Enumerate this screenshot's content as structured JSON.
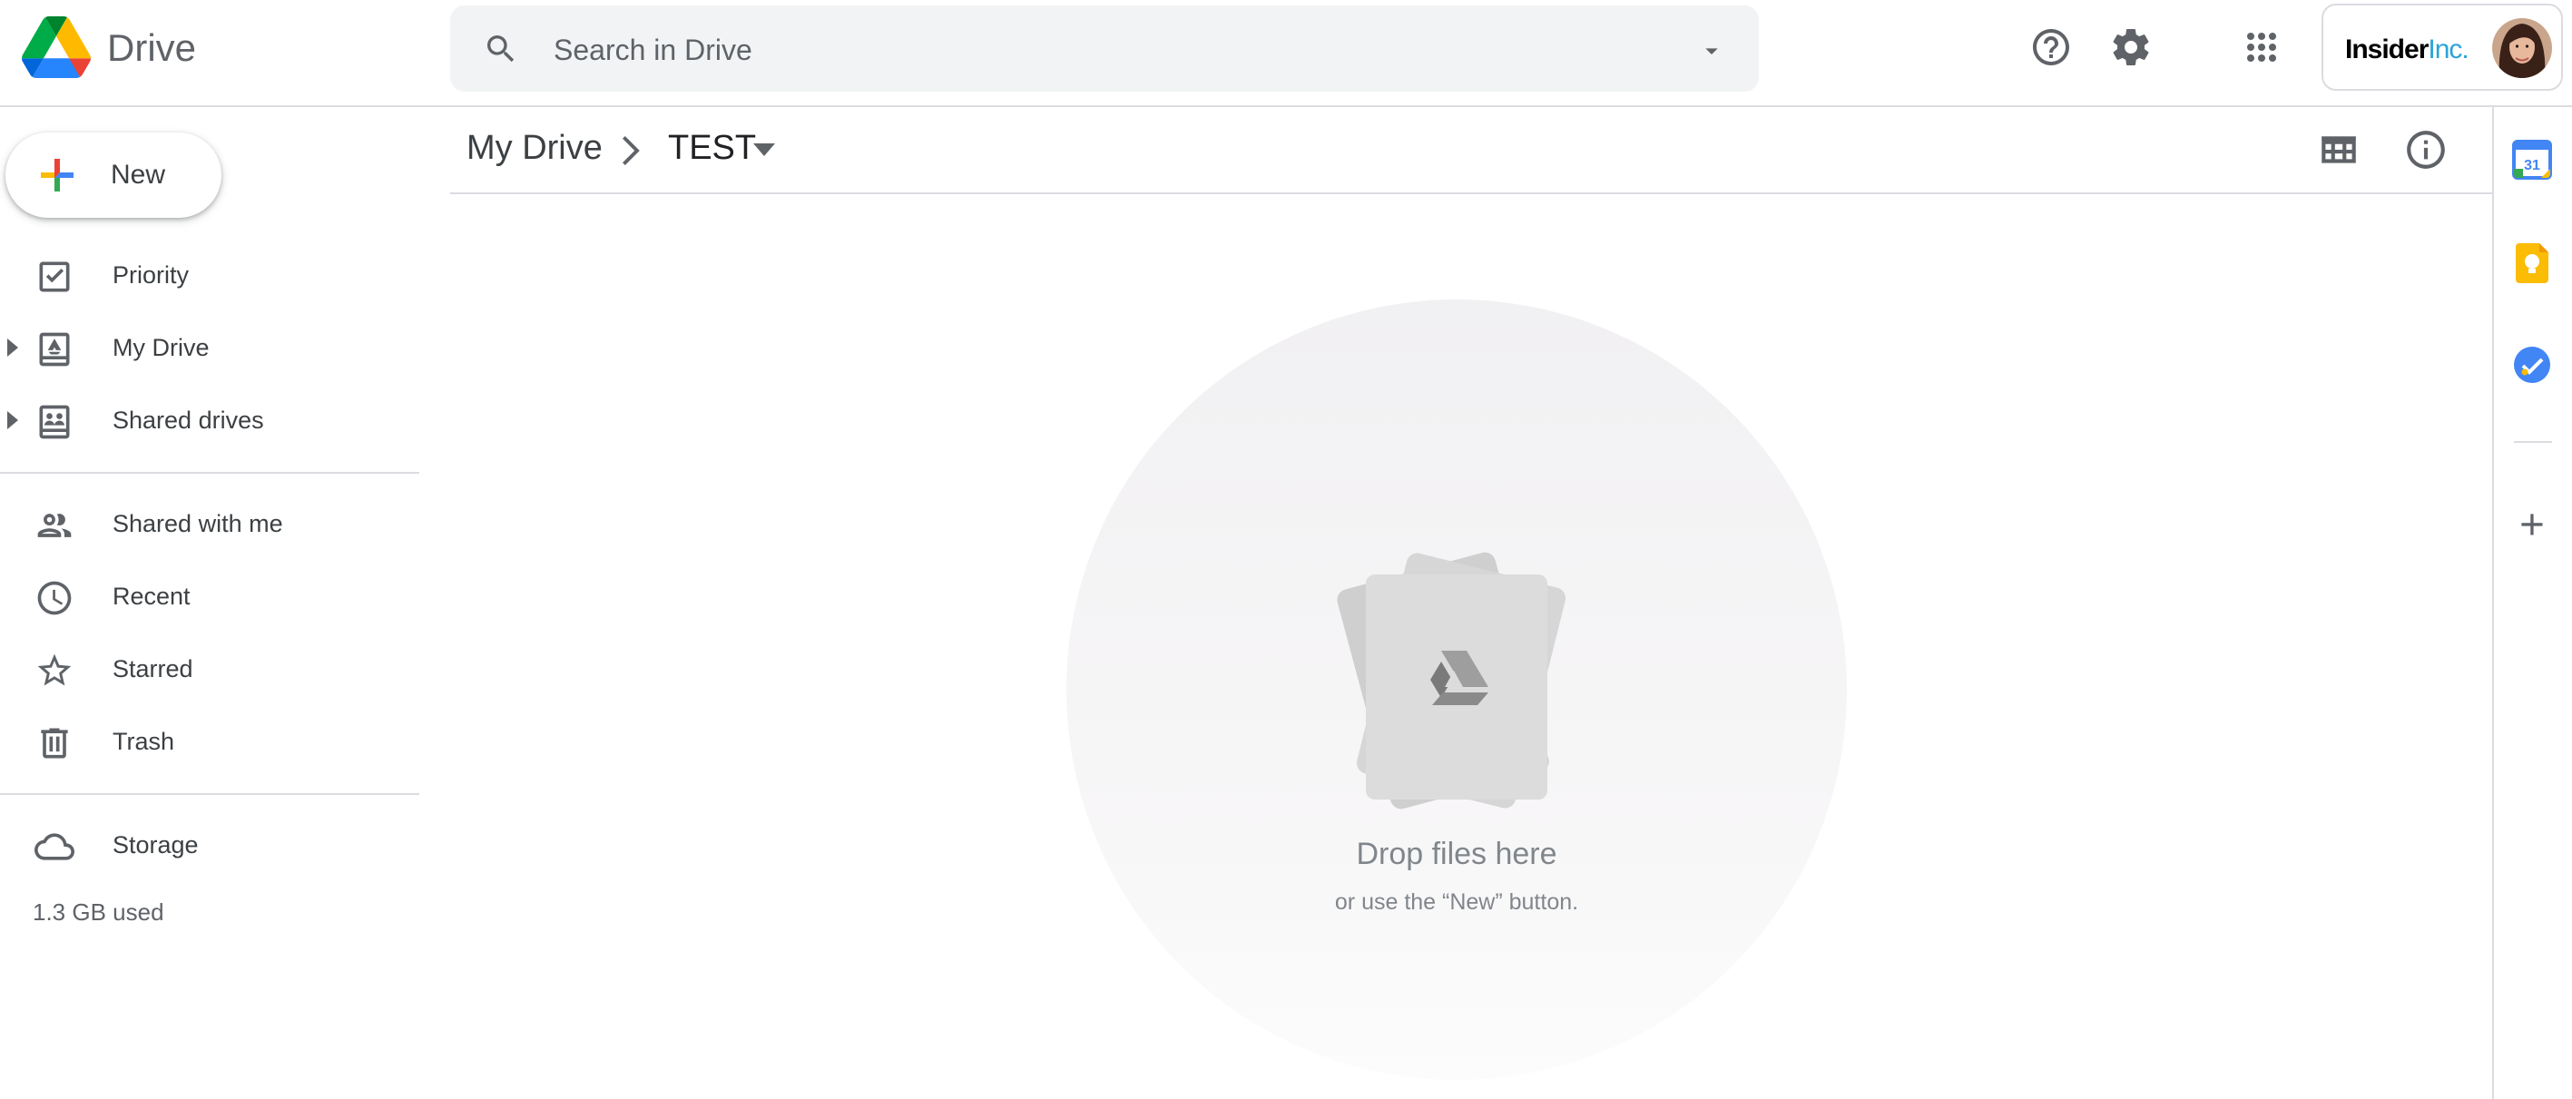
{
  "header": {
    "app_title": "Drive",
    "search": {
      "placeholder": "Search in Drive",
      "value": ""
    },
    "account": {
      "brand_bold": "Insider",
      "brand_light": "Inc."
    }
  },
  "nav": {
    "new_label": "New",
    "items": [
      {
        "label": "Priority",
        "icon": "priority-icon"
      },
      {
        "label": "My Drive",
        "icon": "my-drive-icon"
      },
      {
        "label": "Shared drives",
        "icon": "shared-drives-icon"
      },
      {
        "label": "Shared with me",
        "icon": "people-icon"
      },
      {
        "label": "Recent",
        "icon": "clock-icon"
      },
      {
        "label": "Starred",
        "icon": "star-icon"
      },
      {
        "label": "Trash",
        "icon": "trash-icon"
      },
      {
        "label": "Storage",
        "icon": "cloud-icon"
      }
    ],
    "storage_used": "1.3 GB used"
  },
  "breadcrumb": {
    "root": "My Drive",
    "current": "TEST"
  },
  "empty_state": {
    "title": "Drop files here",
    "subtitle": "or use the “New” button."
  },
  "side_panel": {
    "calendar_day": "31",
    "apps": [
      "calendar-icon",
      "keep-icon",
      "tasks-icon",
      "add-addon-icon"
    ]
  },
  "colors": {
    "blue": "#4285f4",
    "red": "#ea4335",
    "yellow": "#fbbc04",
    "green": "#34a853",
    "brand_light": "#2aa4d8"
  }
}
